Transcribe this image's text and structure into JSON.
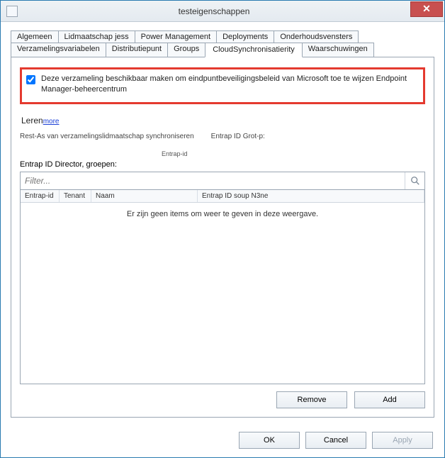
{
  "window": {
    "title": "testeigenschappen",
    "close_label": "✕"
  },
  "tabs": {
    "row1": [
      {
        "label": "Algemeen"
      },
      {
        "label": "Lidmaatschap jess"
      },
      {
        "label": "Power Management"
      },
      {
        "label": "Deployments"
      },
      {
        "label": "Onderhoudsvensters"
      }
    ],
    "row2": [
      {
        "label": "Verzamelingsvariabelen"
      },
      {
        "label": "Distributiepunt"
      },
      {
        "label": "Groups"
      },
      {
        "label": "CloudSynchronisatierity",
        "selected": true
      },
      {
        "label": "Waarschuwingen"
      }
    ]
  },
  "panel": {
    "checkbox_label": "Deze verzameling beschikbaar maken om eindpuntbeveiligingsbeleid van Microsoft toe te wijzen Endpoint Manager-beheercentrum",
    "checkbox_checked": true,
    "learn_label": "Leren",
    "learn_link": "more",
    "sync_label": "Rest-As van verzamelingslidmaatschap synchroniseren",
    "entra_grp": "Entrap ID Grot-p:",
    "entra_small": "Entrap-id",
    "groups_label": "Entrap ID Director, groepen:",
    "filter_placeholder": "Filter...",
    "columns": {
      "c1": "Entrap-id",
      "c2": "Tenant",
      "c3": "Naam",
      "c4": "Entrap ID soup N3ne"
    },
    "empty_text": "Er zijn geen items om weer te geven in deze weergave.",
    "remove_btn": "Remove",
    "add_btn": "Add"
  },
  "footer": {
    "ok": "OK",
    "cancel": "Cancel",
    "apply": "Apply"
  }
}
